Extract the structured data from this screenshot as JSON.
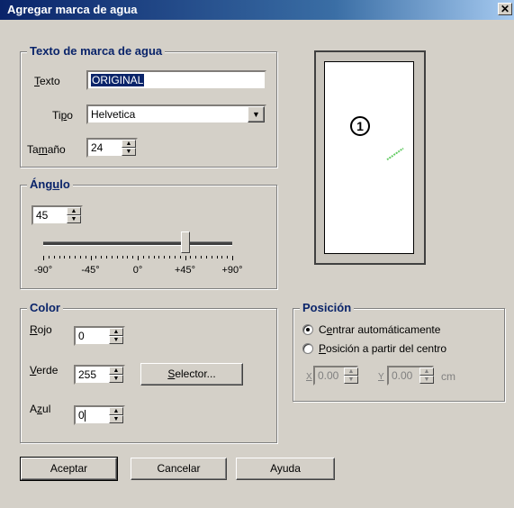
{
  "window": {
    "title": "Agregar marca de agua",
    "close_glyph": "✕"
  },
  "text_group": {
    "legend": "Texto de marca de agua",
    "texto_label": "Texto",
    "texto_value": "ORIGINAL",
    "tipo_label": "Tipo",
    "tipo_value": "Helvetica",
    "tamano_label": "Tamaño",
    "tamano_value": "24"
  },
  "angle_group": {
    "legend": "Ángulo",
    "value": "45",
    "slider_fraction": 0.75,
    "tick_labels": [
      "-90°",
      "-45°",
      "0°",
      "+45°",
      "+90°"
    ]
  },
  "preview": {
    "callout": "1",
    "watermark_color": "#66cc66"
  },
  "color_group": {
    "legend": "Color",
    "rojo_label": "Rojo",
    "rojo_value": "0",
    "verde_label": "Verde",
    "verde_value": "255",
    "azul_label": "Azul",
    "azul_value": "0",
    "selector_label": "Selector..."
  },
  "position_group": {
    "legend": "Posición",
    "option_auto": "Centrar automáticamente",
    "option_center": "Posición a partir del centro",
    "selected": "auto",
    "x_label": "X",
    "x_value": "0.00",
    "y_label": "Y",
    "y_value": "0.00",
    "unit": "cm"
  },
  "buttons": {
    "accept": "Aceptar",
    "cancel": "Cancelar",
    "help": "Ayuda"
  },
  "colors": {
    "title_bar": "#0a246a",
    "legend_text": "#0a246a",
    "dialog_bg": "#d4d0c8"
  }
}
